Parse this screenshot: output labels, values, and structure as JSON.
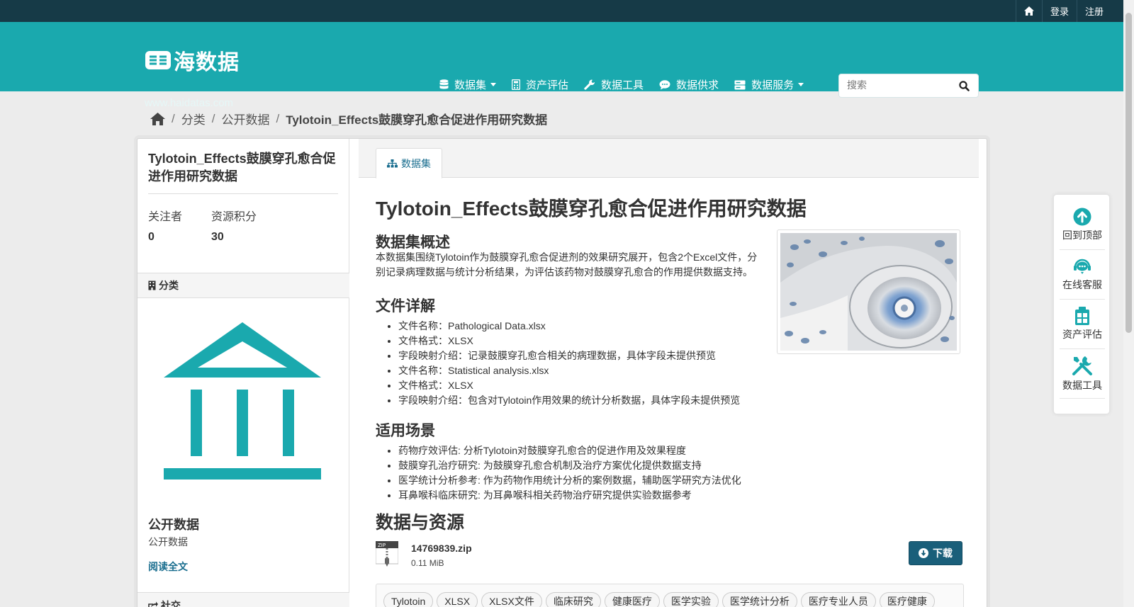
{
  "topbar": {
    "login": "登录",
    "register": "注册"
  },
  "header": {
    "logo_text": "海数据",
    "logo_url": "www.haidatas.com",
    "nav": {
      "datasets": "数据集",
      "asset_eval": "资产评估",
      "data_tools": "数据工具",
      "supply_demand": "数据供求",
      "data_services": "数据服务"
    },
    "search_placeholder": "搜索"
  },
  "breadcrumb": {
    "category": "分类",
    "public": "公开数据",
    "current": "Tylotoin_Effects鼓膜穿孔愈合促进作用研究数据"
  },
  "sidebar": {
    "title": "Tylotoin_Effects鼓膜穿孔愈合促进作用研究数据",
    "followers_label": "关注者",
    "followers_value": "0",
    "points_label": "资源积分",
    "points_value": "30",
    "category_head": "分类",
    "org_name": "公开数据",
    "org_desc": "公开数据",
    "read_more": "阅读全文",
    "social_head": "社交"
  },
  "content": {
    "tab_label": "数据集",
    "title": "Tylotoin_Effects鼓膜穿孔愈合促进作用研究数据",
    "overview_heading": "数据集概述",
    "overview_text": "本数据集围绕Tylotoin作为鼓膜穿孔愈合促进剂的效果研究展开，包含2个Excel文件，分别记录病理数据与统计分析结果，为评估该药物对鼓膜穿孔愈合的作用提供数据支持。",
    "files_heading": "文件详解",
    "files": [
      "文件名称：Pathological Data.xlsx",
      "文件格式：XLSX",
      "字段映射介绍：记录鼓膜穿孔愈合相关的病理数据，具体字段未提供预览",
      "文件名称：Statistical analysis.xlsx",
      "文件格式：XLSX",
      "字段映射介绍：包含对Tylotoin作用效果的统计分析数据，具体字段未提供预览"
    ],
    "scenarios_heading": "适用场景",
    "scenarios": [
      "药物疗效评估: 分析Tylotoin对鼓膜穿孔愈合的促进作用及效果程度",
      "鼓膜穿孔治疗研究: 为鼓膜穿孔愈合机制及治疗方案优化提供数据支持",
      "医学统计分析参考: 作为药物作用统计分析的案例数据，辅助医学研究方法优化",
      "耳鼻喉科临床研究: 为耳鼻喉科相关药物治疗研究提供实验数据参考"
    ],
    "resources_heading": "数据与资源",
    "resource_name": "14769839.zip",
    "resource_size": "0.11 MiB",
    "download_label": "下载",
    "tags": [
      "Tylotoin",
      "XLSX",
      "XLSX文件",
      "临床研究",
      "健康医疗",
      "医学实验",
      "医学统计分析",
      "医疗专业人员",
      "医疗健康"
    ]
  },
  "float_bar": {
    "back_top": "回到顶部",
    "support": "在线客服",
    "asset_eval": "资产评估",
    "tools": "数据工具"
  },
  "colors": {
    "header": "#1aa9ae",
    "topbar": "#163a47",
    "accent": "#1a5f7a"
  }
}
